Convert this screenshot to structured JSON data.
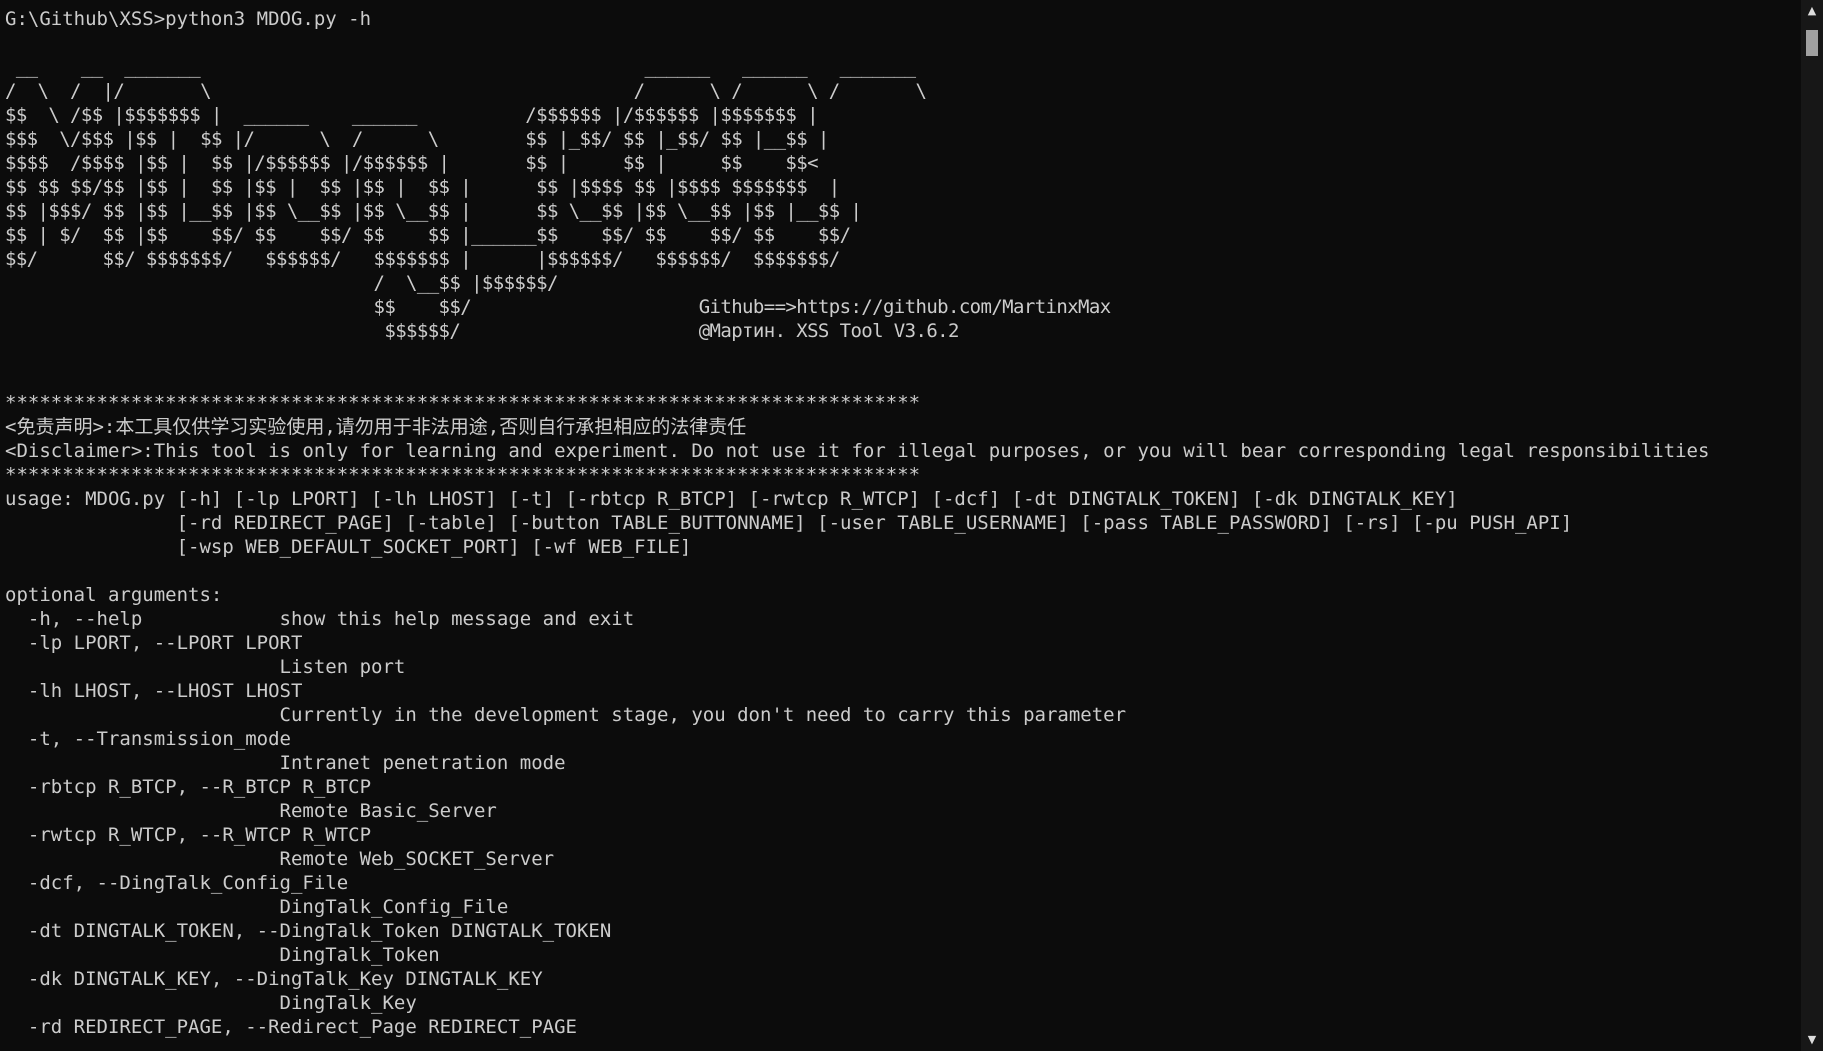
{
  "terminal": {
    "command_line": "G:\\Github\\XSS>python3 MDOG.py -h",
    "banner": [
      " __    __  _______                                         ______   ______   _______ ",
      "/  \\  /  |/       \\                                       /      \\ /      \\ /       \\",
      "$$  \\ /$$ |$$$$$$$ |  ______    ______          /$$$$$$ |/$$$$$$ |$$$$$$$ |",
      "$$$  \\/$$$ |$$ |  $$ |/      \\  /      \\        $$ |_$$/ $$ |_$$/ $$ |__$$ |",
      "$$$$  /$$$$ |$$ |  $$ |/$$$$$$ |/$$$$$$ |       $$ |     $$ |     $$    $$<",
      "$$ $$ $$/$$ |$$ |  $$ |$$ |  $$ |$$ |  $$ |      $$ |$$$$ $$ |$$$$ $$$$$$$  |",
      "$$ |$$$/ $$ |$$ |__$$ |$$ \\__$$ |$$ \\__$$ |      $$ \\__$$ |$$ \\__$$ |$$ |__$$ |",
      "$$ | $/  $$ |$$    $$/ $$    $$/ $$    $$ |______$$    $$/ $$    $$/ $$    $$/",
      "$$/      $$/ $$$$$$$/   $$$$$$/   $$$$$$$ |      |$$$$$$/   $$$$$$/  $$$$$$$/",
      "                                  /  \\__$$ |$$$$$$/",
      "                                  $$    $$/                     Github==>https://github.com/MartinxMax",
      "                                   $$$$$$/                      @Мартин. XSS Tool V3.6.2"
    ],
    "separator": "********************************************************************************",
    "disclaimer_cn": "<免责声明>:本工具仅供学习实验使用,请勿用于非法用途,否则自行承担相应的法律责任",
    "disclaimer_en": "<Disclaimer>:This tool is only for learning and experiment. Do not use it for illegal purposes, or you will bear corresponding legal responsibilities",
    "usage": [
      "usage: MDOG.py [-h] [-lp LPORT] [-lh LHOST] [-t] [-rbtcp R_BTCP] [-rwtcp R_WTCP] [-dcf] [-dt DINGTALK_TOKEN] [-dk DINGTALK_KEY]",
      "               [-rd REDIRECT_PAGE] [-table] [-button TABLE_BUTTONNAME] [-user TABLE_USERNAME] [-pass TABLE_PASSWORD] [-rs] [-pu PUSH_API]",
      "               [-wsp WEB_DEFAULT_SOCKET_PORT] [-wf WEB_FILE]"
    ],
    "options_header": "optional arguments:",
    "options": [
      "  -h, --help            show this help message and exit",
      "  -lp LPORT, --LPORT LPORT",
      "                        Listen port",
      "  -lh LHOST, --LHOST LHOST",
      "                        Currently in the development stage, you don't need to carry this parameter",
      "  -t, --Transmission_mode",
      "                        Intranet penetration mode",
      "  -rbtcp R_BTCP, --R_BTCP R_BTCP",
      "                        Remote Basic_Server",
      "  -rwtcp R_WTCP, --R_WTCP R_WTCP",
      "                        Remote Web_SOCKET_Server",
      "  -dcf, --DingTalk_Config_File",
      "                        DingTalk_Config_File",
      "  -dt DINGTALK_TOKEN, --DingTalk_Token DINGTALK_TOKEN",
      "                        DingTalk_Token",
      "  -dk DINGTALK_KEY, --DingTalk_Key DINGTALK_KEY",
      "                        DingTalk_Key",
      "  -rd REDIRECT_PAGE, --Redirect_Page REDIRECT_PAGE"
    ]
  },
  "scrollbar": {
    "up_icon": "▲",
    "down_icon": "▼",
    "position": 0
  },
  "colors": {
    "background": "#0c0c0c",
    "text": "#cccccc",
    "scrollbar_track": "#171717",
    "scrollbar_thumb": "#a0a0a0"
  }
}
